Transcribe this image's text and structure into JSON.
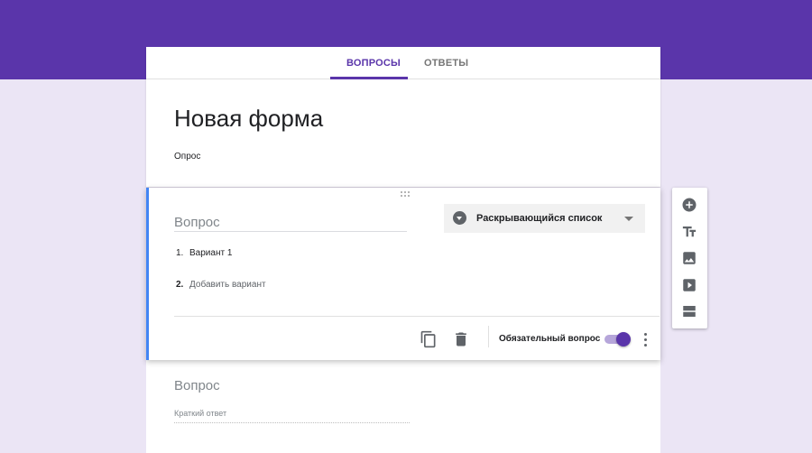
{
  "tabs": {
    "questions": "ВОПРОСЫ",
    "answers": "ОТВЕТЫ"
  },
  "form": {
    "title": "Новая форма",
    "description": "Опрос"
  },
  "question1": {
    "title_placeholder": "Вопрос",
    "type_selected": "Раскрывающийся список",
    "options": [
      {
        "num": "1.",
        "label": "Вариант 1"
      },
      {
        "num": "2.",
        "label": "Добавить вариант"
      }
    ],
    "required_label": "Обязательный вопрос",
    "required": true
  },
  "question2": {
    "title_placeholder": "Вопрос",
    "answer_placeholder": "Краткий ответ"
  },
  "colors": {
    "accent": "#5a35aa",
    "selected_border": "#4285f4",
    "background": "#ebe5f5"
  },
  "toolbar_icons": [
    "add-question-icon",
    "add-title-icon",
    "add-image-icon",
    "add-video-icon",
    "add-section-icon"
  ]
}
